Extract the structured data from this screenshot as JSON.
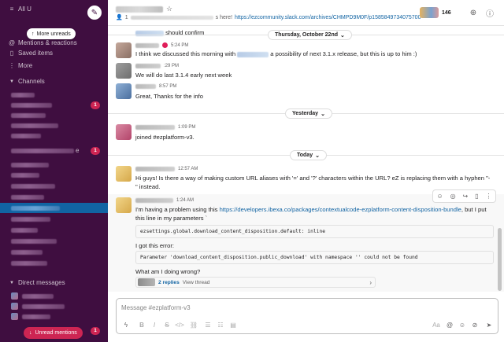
{
  "sidebar": {
    "all_unreads": "All U",
    "mentions": "Mentions & reactions",
    "saved": "Saved items",
    "more": "More",
    "more_unreads": "More unreads",
    "channels_header": "Channels",
    "channel_badges": [
      "1",
      "1",
      "1"
    ],
    "dm_header": "Direct messages",
    "dm_badge": "1",
    "unread_mentions": "Unread mentions",
    "channel_fragment": "e"
  },
  "header": {
    "topic_prefix": "1",
    "topic_text": "s here!",
    "topic_link": "https://ezcommunity.slack.com/archives/CHMPD9M0F/p1585849734075700",
    "member_count": "146"
  },
  "messages": {
    "m0_text": "should confirm",
    "date_pill_1": "Thursday, October 22nd",
    "m1_time": "5:24 PM",
    "m1_text_a": "I think we discussed this morning with",
    "m1_text_b": "a possibility of next 3.1.x release, but this is up to him :)",
    "m2_time": ":29 PM",
    "m2_text": "We will do last 3.1.4 early next week",
    "m3_time": "8:57 PM",
    "m3_text": "Great, Thanks for the info",
    "date_pill_2": "Yesterday",
    "m4_time": "1:09 PM",
    "m4_text": "joined #ezplatform-v3.",
    "date_pill_3": "Today",
    "m5_time": "12:57 AM",
    "m5_text": "Hi guys! Is there a way of making custom URL aliases with '=' and '?' characters within the URL? eZ is replacing them with a hyphen \"-\" instead.",
    "m6_time": "1:24 AM",
    "m6_text_a": "I'm having a problem using this",
    "m6_link": "https://developers.ibexa.co/packages/contextualcode-ezplatform-content-disposition-bundle",
    "m6_text_b": ", but I put this line in my parameters `",
    "code_1": "ezsettings.global.download_content_disposition.default: inline",
    "m6_error_label": "I got this error:",
    "code_2": "Parameter 'download_content_disposition.public_download' with namespace '' could not be found",
    "m6_question": "What am I doing wrong?",
    "replies": "2 replies",
    "view_thread": "View thread"
  },
  "composer": {
    "placeholder": "Message #ezplatform-v3",
    "tb_bold": "B",
    "tb_italic": "I",
    "tb_strike": "S",
    "tb_code": "</>",
    "tb_aa": "Aa"
  },
  "colors": {
    "sidebar_bg": "#3f0e40",
    "active_channel": "#1164a3",
    "badge": "#cd2553",
    "link": "#1264a3"
  }
}
